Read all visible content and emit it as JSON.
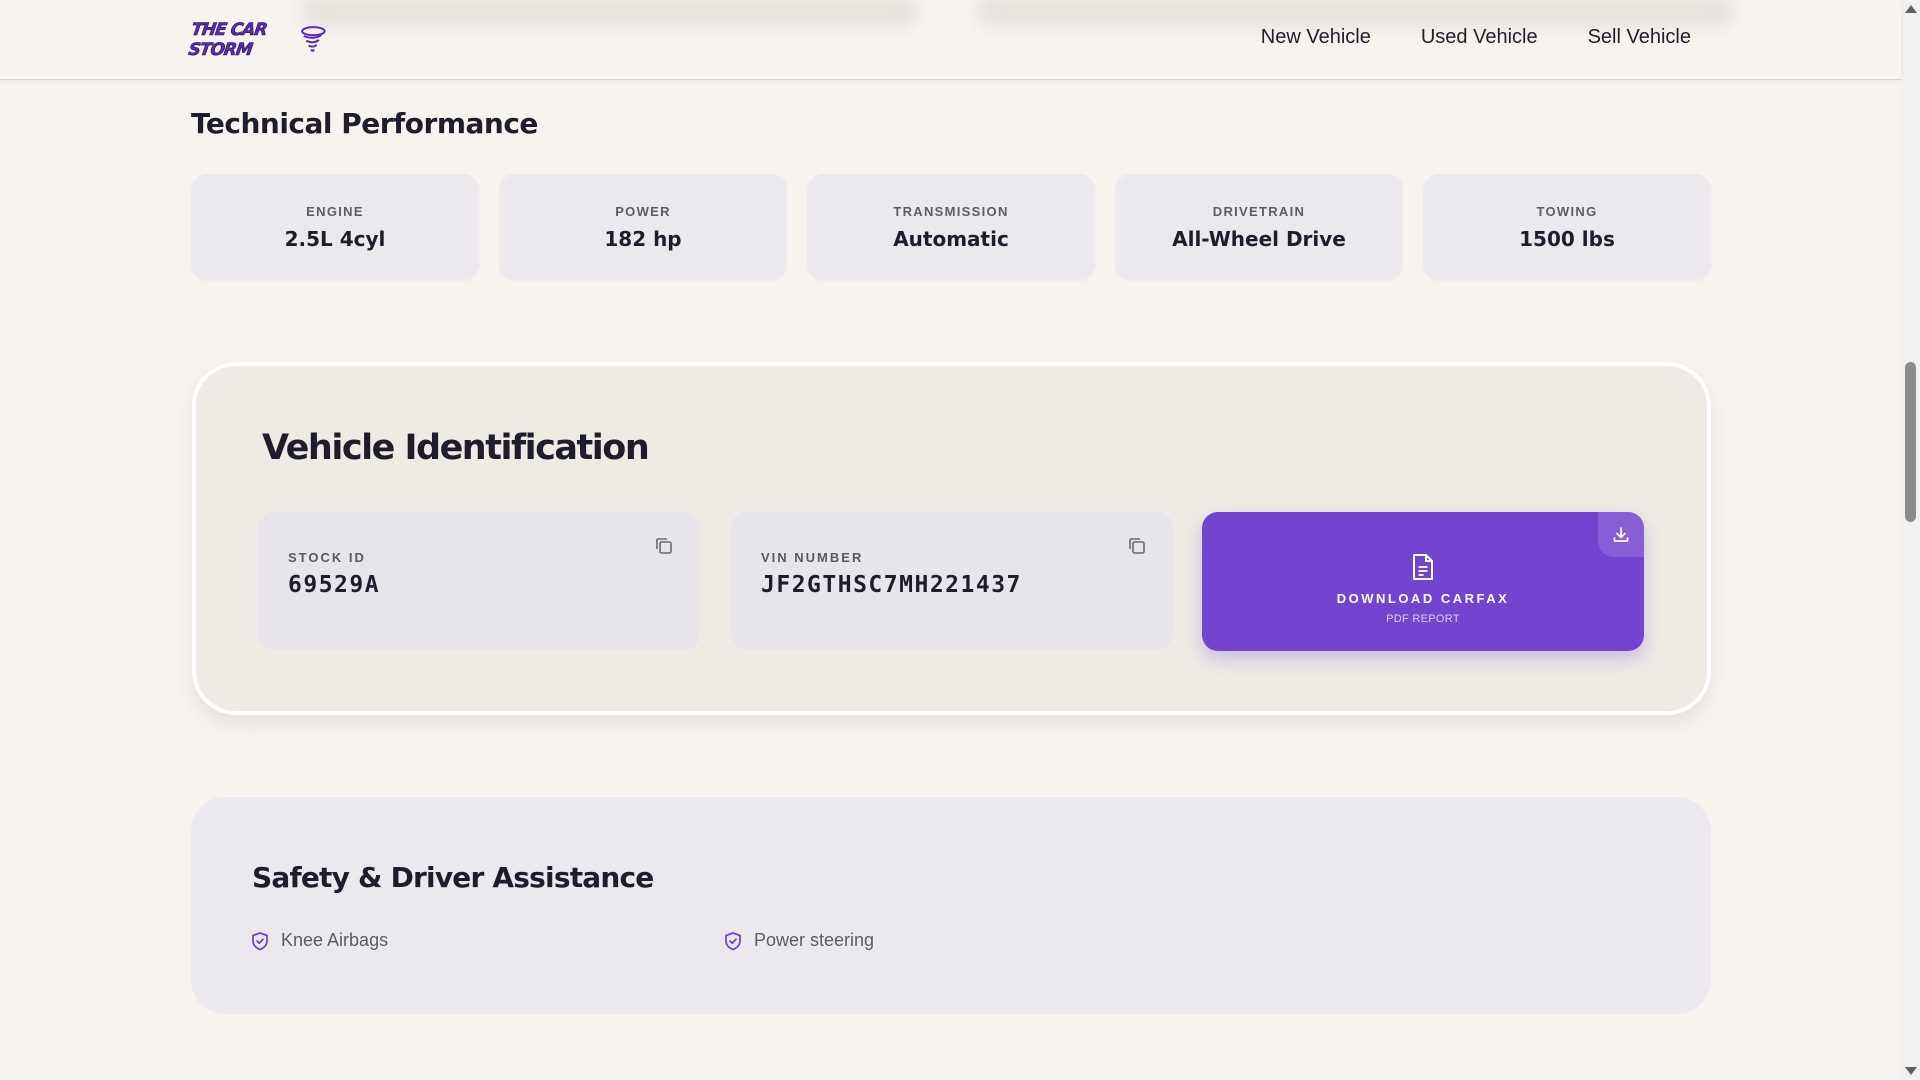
{
  "header": {
    "logo_text": "THE CAR STORM",
    "nav": [
      "New Vehicle",
      "Used Vehicle",
      "Sell Vehicle"
    ]
  },
  "technical": {
    "title": "Technical Performance",
    "specs": [
      {
        "label": "ENGINE",
        "value": "2.5L 4cyl"
      },
      {
        "label": "POWER",
        "value": "182 hp"
      },
      {
        "label": "TRANSMISSION",
        "value": "Automatic"
      },
      {
        "label": "DRIVETRAIN",
        "value": "All-Wheel Drive"
      },
      {
        "label": "TOWING",
        "value": "1500 lbs"
      }
    ]
  },
  "identification": {
    "title": "Vehicle Identification",
    "stock": {
      "label": "STOCK ID",
      "value": "69529A"
    },
    "vin": {
      "label": "VIN NUMBER",
      "value": "JF2GTHSC7MH221437"
    },
    "carfax": {
      "label": "DOWNLOAD CARFAX",
      "sub": "PDF REPORT"
    }
  },
  "safety": {
    "title": "Safety & Driver Assistance",
    "features": [
      "Knee Airbags",
      "Power steering"
    ]
  },
  "colors": {
    "accent": "#7444d0",
    "background": "#f7f4ef",
    "card": "#ebe8ee"
  },
  "icons": [
    "copy-icon",
    "document-icon",
    "download-icon",
    "shield-check-icon"
  ]
}
